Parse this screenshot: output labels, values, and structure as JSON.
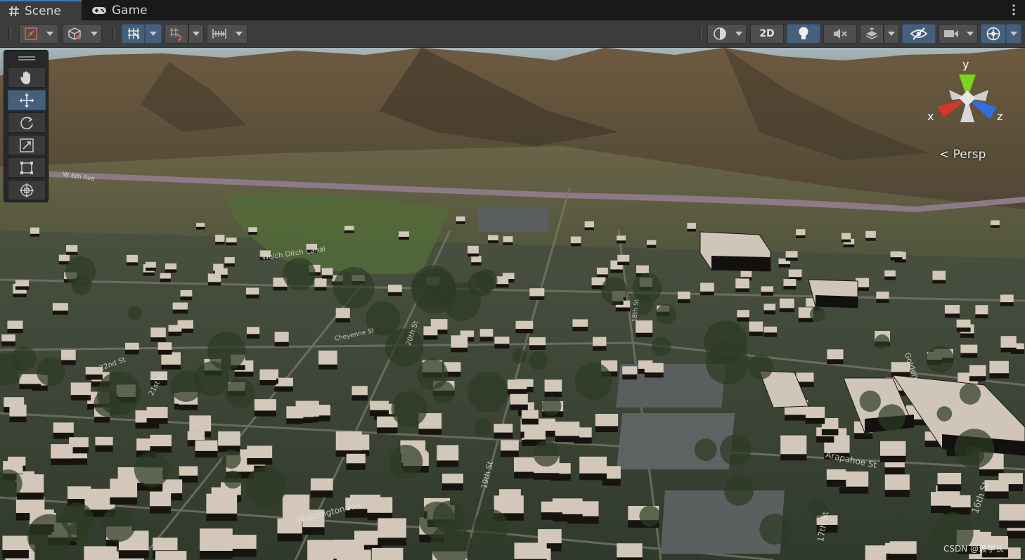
{
  "tabs": [
    {
      "label": "Scene",
      "icon": "hash-icon",
      "active": true
    },
    {
      "label": "Game",
      "icon": "gamepad-icon",
      "active": false
    }
  ],
  "toolbar": {
    "left_buttons": [
      {
        "name": "tool-handle-position-button",
        "icon": "pivot-icon"
      },
      {
        "name": "tool-handle-rotation-button",
        "icon": "cube-local-icon"
      },
      {
        "name": "grid-snapping-button",
        "icon": "grid-snap-icon",
        "active": true
      },
      {
        "name": "incremental-snap-button",
        "icon": "increment-snap-icon"
      },
      {
        "name": "ruler-snap-button",
        "icon": "ruler-icon"
      }
    ],
    "right_buttons": [
      {
        "name": "draw-mode-button",
        "icon": "shading-sphere-icon"
      },
      {
        "name": "2d-toggle-button",
        "label": "2D"
      },
      {
        "name": "lighting-toggle-button",
        "icon": "lightbulb-icon",
        "active": true
      },
      {
        "name": "audio-toggle-button",
        "icon": "audio-mute-icon"
      },
      {
        "name": "effects-button",
        "icon": "effects-stack-icon"
      },
      {
        "name": "scene-visibility-button",
        "icon": "eye-slash-icon",
        "active": true
      },
      {
        "name": "camera-button",
        "icon": "camera-icon"
      },
      {
        "name": "gizmos-button",
        "icon": "gizmo-globe-icon",
        "active": true
      }
    ],
    "two_d_label": "2D"
  },
  "tools": [
    {
      "name": "hand-tool",
      "icon": "hand-icon"
    },
    {
      "name": "move-tool",
      "icon": "move-arrows-icon",
      "active": true
    },
    {
      "name": "rotate-tool",
      "icon": "rotate-icon"
    },
    {
      "name": "scale-tool",
      "icon": "scale-icon"
    },
    {
      "name": "rect-tool",
      "icon": "rect-icon"
    },
    {
      "name": "transform-tool",
      "icon": "transform-icon"
    }
  ],
  "gizmo": {
    "x_label": "x",
    "y_label": "y",
    "z_label": "z",
    "projection_label": "Persp",
    "x_color": "#d9352a",
    "y_color": "#7ed321",
    "z_color": "#2f6fe0"
  },
  "map_labels": [
    "W 6th Ave",
    "Welch Ditch Canal",
    "19th St",
    "18th St",
    "20th St",
    "21st St",
    "22nd St",
    "Washington Ave",
    "Arapahoe St",
    "17th St",
    "16th St",
    "Cheyenne St",
    "Golden"
  ],
  "watermark": "CSDN @玻学长",
  "colors": {
    "accent_blue": "#46607c",
    "panel": "#3c3c3c",
    "tabbar": "#191919"
  }
}
